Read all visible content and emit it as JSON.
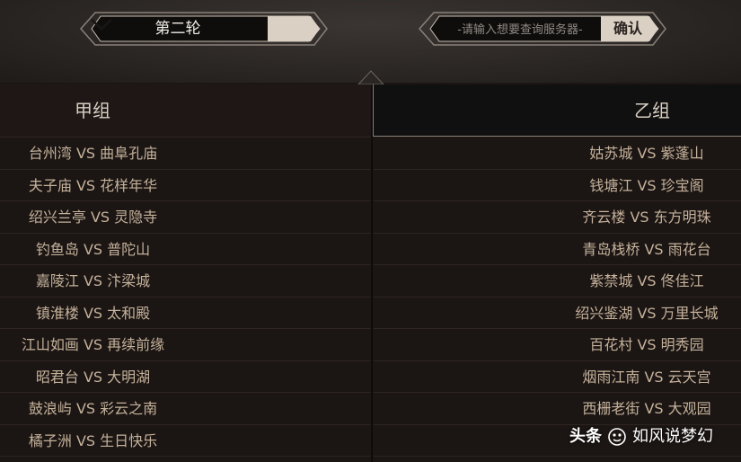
{
  "round_select": {
    "selected": "第二轮"
  },
  "search": {
    "placeholder": "-请输入想要查询服务器-",
    "value": "",
    "confirm_label": "确认"
  },
  "groups": {
    "a": {
      "title": "甲组",
      "matches": [
        "台州湾 VS 曲阜孔庙",
        "夫子庙 VS 花样年华",
        "绍兴兰亭 VS 灵隐寺",
        "钓鱼岛 VS 普陀山",
        "嘉陵江 VS 汴梁城",
        "镇淮楼 VS 太和殿",
        "江山如画 VS 再续前缘",
        "昭君台 VS 大明湖",
        "鼓浪屿 VS 彩云之南",
        "橘子洲 VS 生日快乐"
      ]
    },
    "b": {
      "title": "乙组",
      "matches": [
        "姑苏城 VS 紫蓬山",
        "钱塘江 VS 珍宝阁",
        "齐云楼 VS 东方明珠",
        "青岛栈桥 VS 雨花台",
        "紫禁城 VS 佟佳江",
        "绍兴鉴湖 VS 万里长城",
        "百花村 VS 明秀园",
        "烟雨江南 VS 云天宫",
        "西栅老街 VS 大观园",
        ""
      ]
    }
  },
  "watermark": {
    "source": "头条",
    "author": "如风说梦幻"
  }
}
